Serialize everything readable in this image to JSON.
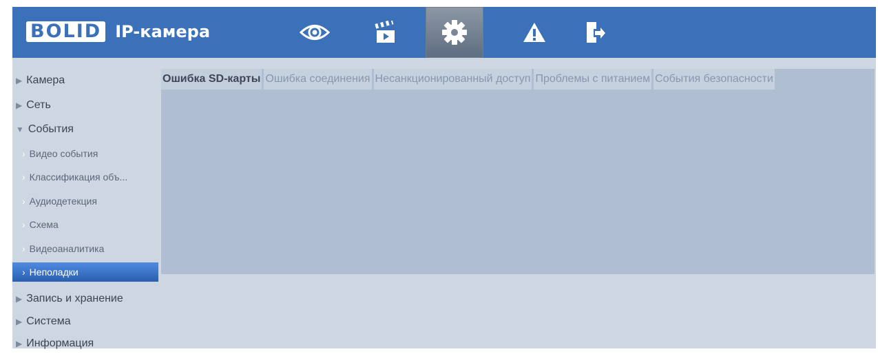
{
  "header": {
    "logo_text": "BOLID",
    "title": "IP-камера",
    "nav_buttons": [
      {
        "name": "live-view",
        "icon": "eye-icon"
      },
      {
        "name": "playback",
        "icon": "clapperboard-icon"
      },
      {
        "name": "settings",
        "icon": "gear-icon",
        "active": true
      },
      {
        "name": "alarm",
        "icon": "warning-icon"
      },
      {
        "name": "logout",
        "icon": "exit-icon"
      }
    ]
  },
  "sidebar": {
    "items": [
      {
        "label": "Камера",
        "expanded": false
      },
      {
        "label": "Сеть",
        "expanded": false
      },
      {
        "label": "События",
        "expanded": true
      },
      {
        "label": "Запись и хранение",
        "expanded": false
      },
      {
        "label": "Система",
        "expanded": false
      },
      {
        "label": "Информация",
        "expanded": false
      }
    ],
    "subitems": [
      {
        "label": "Видео события"
      },
      {
        "label": "Классификация объ..."
      },
      {
        "label": "Аудиодетекция"
      },
      {
        "label": "Схема"
      },
      {
        "label": "Видеоаналитика"
      },
      {
        "label": "Неполадки",
        "active": true
      }
    ]
  },
  "tabs": [
    {
      "label": "Ошибка SD-карты",
      "active": true
    },
    {
      "label": "Ошибка соединения"
    },
    {
      "label": "Несанкционированный доступ"
    },
    {
      "label": "Проблемы с питанием"
    },
    {
      "label": "События безопасности"
    }
  ],
  "colors": {
    "header": "#3b71b8",
    "content_bg": "#cdd6e1",
    "panel_bg": "#b0bed2",
    "active_menu": "#3a74cf"
  }
}
